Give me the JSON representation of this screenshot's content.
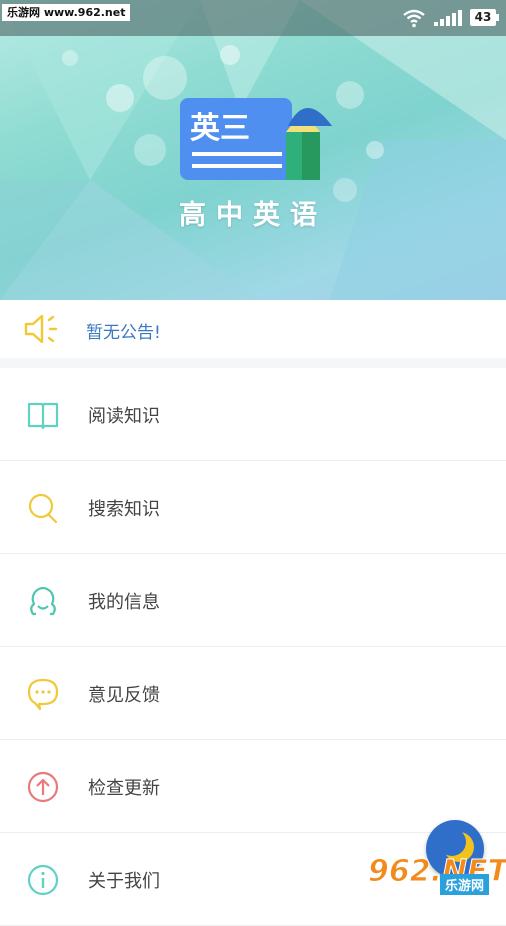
{
  "status_bar": {
    "watermark": "乐游网 www.962.net",
    "battery": "43"
  },
  "hero": {
    "logo_text": "英三",
    "app_name": "高中英语"
  },
  "notice": {
    "text": "暂无公告!"
  },
  "menu": {
    "items": [
      {
        "label": "阅读知识",
        "icon": "book-icon",
        "color": "#5fd3c2"
      },
      {
        "label": "搜索知识",
        "icon": "search-icon",
        "color": "#f0c93a"
      },
      {
        "label": "我的信息",
        "icon": "user-icon",
        "color": "#4fc6b0"
      },
      {
        "label": "意见反馈",
        "icon": "chat-bubble-icon",
        "color": "#f0c93a"
      },
      {
        "label": "检查更新",
        "icon": "arrow-up-circle-icon",
        "color": "#e97a7a"
      },
      {
        "label": "关于我们",
        "icon": "info-icon",
        "color": "#5fd3c2"
      }
    ]
  },
  "badge": {
    "site": "962.NET",
    "cn": "乐游网"
  }
}
